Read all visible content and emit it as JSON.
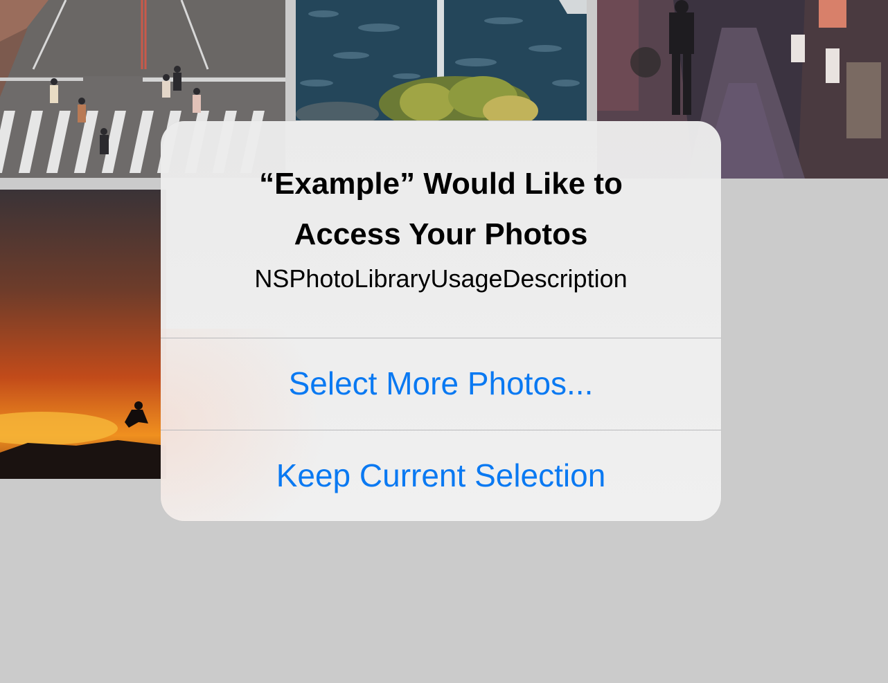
{
  "colors": {
    "backdrop": "#cbcbcb",
    "dialog_background": "#efefef",
    "title_text": "#000000",
    "action_text": "#0a79f2",
    "divider": "#b9b9bb"
  },
  "background_photos": [
    {
      "name": "photo-crosswalk",
      "subject": "aerial view of pedestrians on a crosswalk"
    },
    {
      "name": "photo-river",
      "subject": "aerial view of a river with a bridge and trees"
    },
    {
      "name": "photo-alley",
      "subject": "person walking down a narrow lantern-lit alley"
    },
    {
      "name": "photo-sunset",
      "subject": "silhouette of a person jumping at sunset"
    }
  ],
  "alert": {
    "title": "“Example” Would Like to Access Your Photos",
    "message": "NSPhotoLibraryUsageDescription",
    "actions": [
      {
        "label": "Select More Photos..."
      },
      {
        "label": "Keep Current Selection"
      }
    ]
  }
}
